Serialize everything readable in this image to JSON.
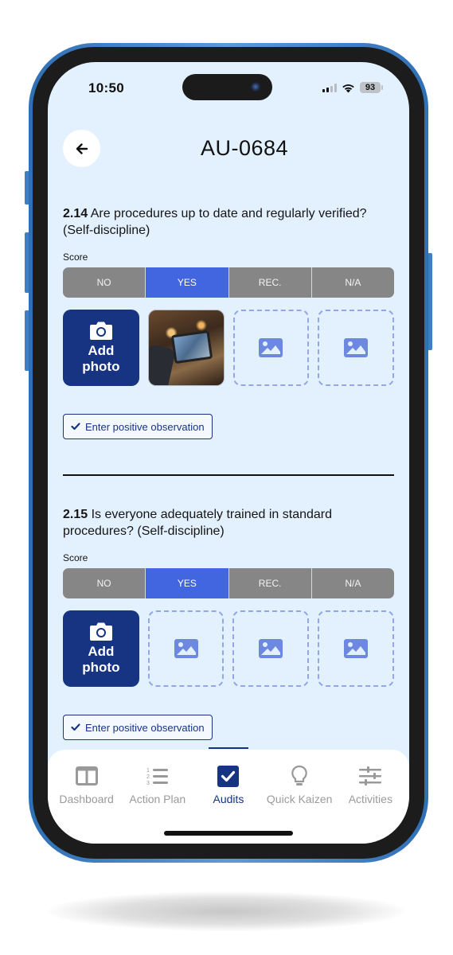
{
  "status_bar": {
    "time": "10:50",
    "battery": "93"
  },
  "header": {
    "title": "AU-0684",
    "back_icon": "arrow-left-icon"
  },
  "questions": [
    {
      "number": "2.14",
      "text": "Are procedures up to date and regularly verified? (Self-discipline)",
      "score_label": "Score",
      "options": [
        "NO",
        "YES",
        "REC.",
        "N/A"
      ],
      "selected": "YES",
      "add_photo_label_1": "Add",
      "add_photo_label_2": "photo",
      "photos": [
        "tablet-in-factory-photo",
        "empty",
        "empty"
      ],
      "observation_label": "Enter positive observation"
    },
    {
      "number": "2.15",
      "text": "Is everyone adequately trained in standard procedures? (Self-discipline)",
      "score_label": "Score",
      "options": [
        "NO",
        "YES",
        "REC.",
        "N/A"
      ],
      "selected": "YES",
      "add_photo_label_1": "Add",
      "add_photo_label_2": "photo",
      "photos": [
        "empty",
        "empty",
        "empty"
      ],
      "observation_label": "Enter positive observation"
    }
  ],
  "tabbar": {
    "items": [
      {
        "label": "Dashboard",
        "icon": "columns-icon",
        "active": false
      },
      {
        "label": "Action Plan",
        "icon": "numbered-list-icon",
        "active": false
      },
      {
        "label": "Audits",
        "icon": "checkbox-icon",
        "active": true
      },
      {
        "label": "Quick Kaizen",
        "icon": "lightbulb-icon",
        "active": false
      },
      {
        "label": "Activities",
        "icon": "sliders-icon",
        "active": false
      }
    ]
  },
  "colors": {
    "primary": "#163482",
    "selected_score": "#4266e0",
    "unselected_score": "#868686",
    "screen_bg": "#e3f0fd",
    "placeholder": "#93a6e6"
  }
}
